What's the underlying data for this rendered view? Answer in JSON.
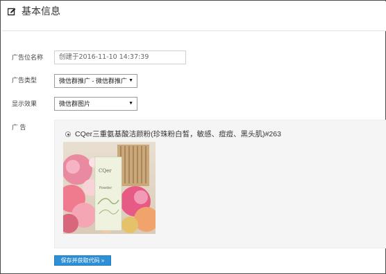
{
  "header": {
    "title": "基本信息",
    "icon": "edit-icon"
  },
  "form": {
    "ad_position_name": {
      "label": "广告位名称",
      "value": "创建于2016-11-10 14:37:39"
    },
    "ad_type": {
      "label": "广告类型",
      "value": "微信群推广 - 微信群推广"
    },
    "display_effect": {
      "label": "显示效果",
      "value": "微信群图片"
    },
    "ad": {
      "label": "广 告",
      "items": [
        {
          "name": "CQer三重氨基酸洁颜粉(珍珠粉白皙，敏感、痘痘、黑头肌)#263",
          "selected": true,
          "image_text": {
            "brand": "CQer",
            "product": "Powder"
          }
        }
      ]
    }
  },
  "actions": {
    "save_label": "保存并获取代码 »"
  },
  "colors": {
    "primary": "#2d8fd6",
    "panel_bg": "#f5f5f5",
    "border": "#4a4a4a"
  }
}
